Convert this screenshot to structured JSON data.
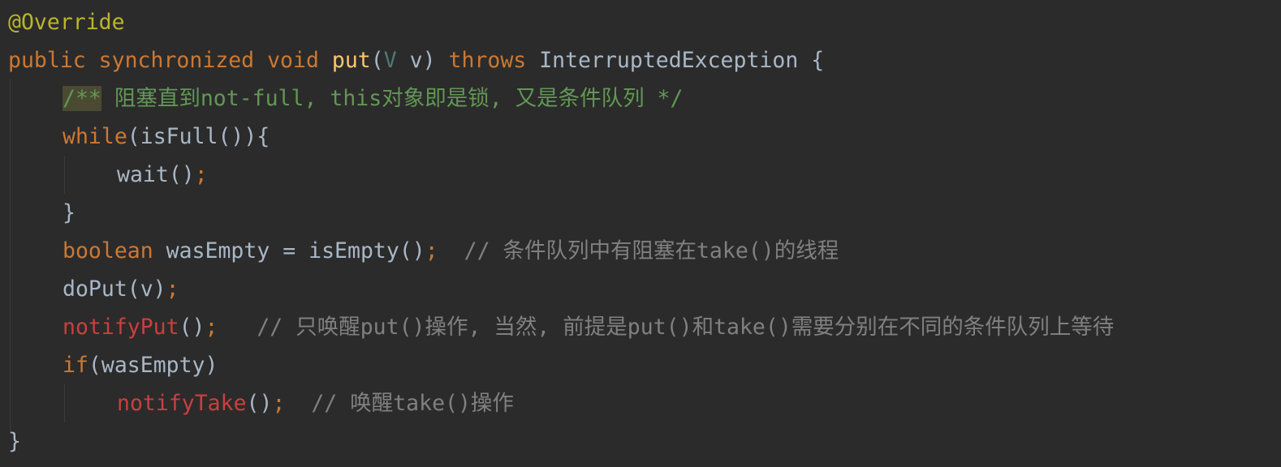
{
  "editor": {
    "indent_unit": "    ",
    "lines": [
      {
        "indent": 0,
        "tokens": [
          {
            "text": "@Override",
            "type": "ann"
          }
        ]
      },
      {
        "indent": 0,
        "tokens": [
          {
            "text": "public synchronized void ",
            "type": "kw"
          },
          {
            "text": "put",
            "type": "fn"
          },
          {
            "text": "(",
            "type": "plain"
          },
          {
            "text": "V",
            "type": "gen"
          },
          {
            "text": " v) ",
            "type": "plain"
          },
          {
            "text": "throws ",
            "type": "kw"
          },
          {
            "text": "InterruptedException {",
            "type": "plain"
          }
        ]
      },
      {
        "indent": 1,
        "tokens": [
          {
            "text": "/**",
            "type": "docmark"
          },
          {
            "text": " 阻塞直到not-full, this对象即是锁, 又是条件队列 */",
            "type": "doc"
          }
        ]
      },
      {
        "indent": 1,
        "tokens": [
          {
            "text": "while",
            "type": "kw"
          },
          {
            "text": "(isFull()){",
            "type": "plain"
          }
        ]
      },
      {
        "indent": 2,
        "tokens": [
          {
            "text": "wait()",
            "type": "plain"
          },
          {
            "text": ";",
            "type": "semi"
          }
        ]
      },
      {
        "indent": 1,
        "tokens": [
          {
            "text": "}",
            "type": "plain"
          }
        ]
      },
      {
        "indent": 1,
        "tokens": [
          {
            "text": "boolean ",
            "type": "kw"
          },
          {
            "text": "wasEmpty = isEmpty()",
            "type": "plain"
          },
          {
            "text": ";",
            "type": "semi"
          },
          {
            "text": "  // 条件队列中有阻塞在take()的线程",
            "type": "cmt"
          }
        ]
      },
      {
        "indent": 1,
        "tokens": [
          {
            "text": "doPut(v)",
            "type": "plain"
          },
          {
            "text": ";",
            "type": "semi"
          }
        ]
      },
      {
        "indent": 1,
        "tokens": [
          {
            "text": "notifyPut",
            "type": "call"
          },
          {
            "text": "()",
            "type": "plain"
          },
          {
            "text": ";",
            "type": "semi"
          },
          {
            "text": "   // 只唤醒put()操作, 当然, 前提是put()和take()需要分别在不同的条件队列上等待",
            "type": "cmt"
          }
        ]
      },
      {
        "indent": 1,
        "tokens": [
          {
            "text": "if",
            "type": "kw"
          },
          {
            "text": "(wasEmpty)",
            "type": "plain"
          }
        ]
      },
      {
        "indent": 2,
        "tokens": [
          {
            "text": "notifyTake",
            "type": "call"
          },
          {
            "text": "()",
            "type": "plain"
          },
          {
            "text": ";",
            "type": "semi"
          },
          {
            "text": "  // 唤醒take()操作",
            "type": "cmt"
          }
        ]
      },
      {
        "indent": 0,
        "tokens": [
          {
            "text": "}",
            "type": "plain"
          }
        ]
      }
    ]
  }
}
